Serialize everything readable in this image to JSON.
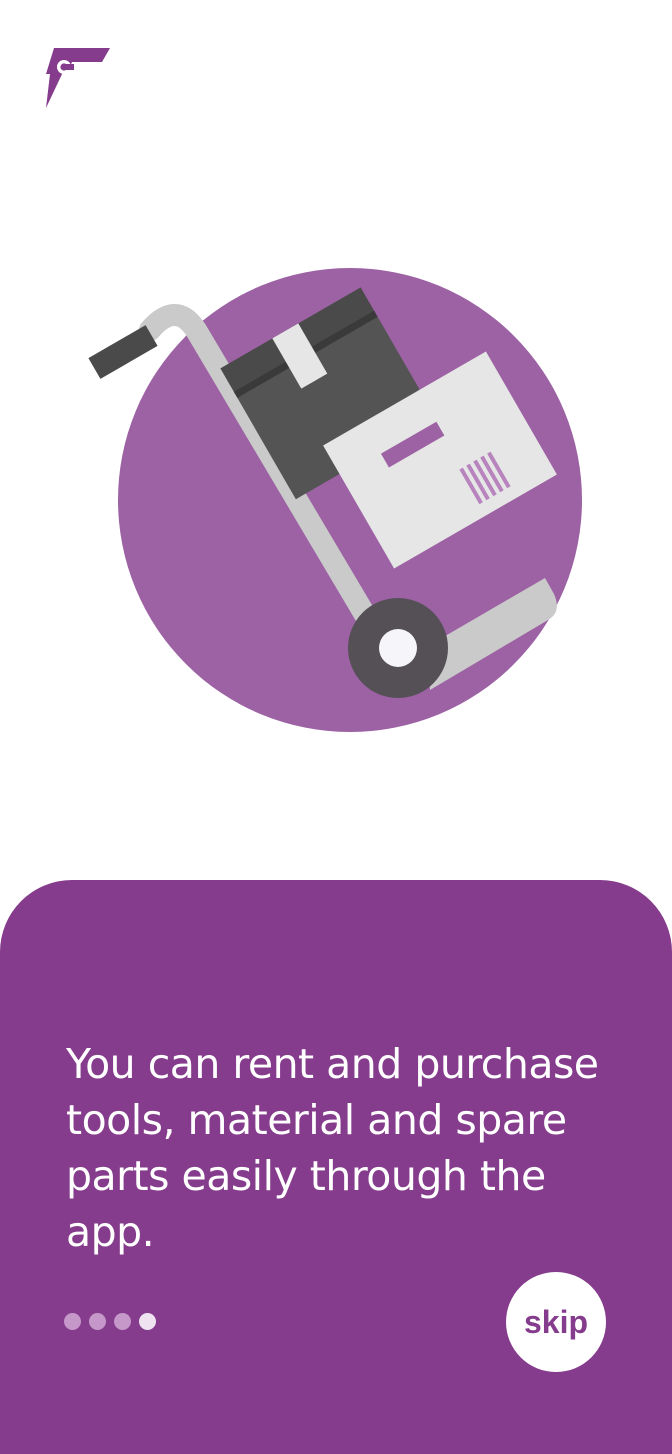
{
  "brand": {
    "logo_icon": "flash-wrench-logo-icon",
    "accent_color": "#853c8c"
  },
  "hero": {
    "icon": "hand-truck-boxes-icon",
    "circle_color": "#9c62a4"
  },
  "onboarding": {
    "message": "You can rent and purchase\ntools, material and spare\nparts easily through the app.",
    "page_indicator": {
      "total": 4,
      "current": 4
    },
    "skip_label": "skip"
  }
}
